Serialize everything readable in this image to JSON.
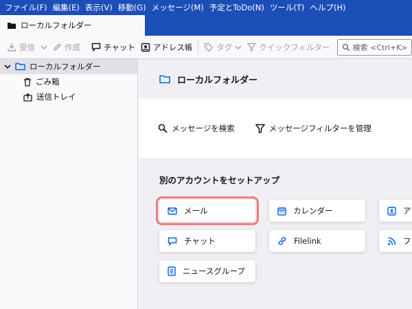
{
  "menu": [
    "ファイル(F)",
    "編集(E)",
    "表示(V)",
    "移動(G)",
    "メッセージ(M)",
    "予定とToDo(N)",
    "ツール(T)",
    "ヘルプ(H)"
  ],
  "tab": {
    "label": "ローカルフォルダー"
  },
  "toolbar": {
    "get_mail": "受信",
    "write": "作成",
    "chat": "チャット",
    "address_book": "アドレス帳",
    "tag": "タグ",
    "quick_filter": "クイックフィルター",
    "search_placeholder": "検索 <Ctrl+K>"
  },
  "sidebar": {
    "account": "ローカルフォルダー",
    "folders": [
      "ごみ箱",
      "送信トレイ"
    ]
  },
  "content": {
    "title": "ローカルフォルダー",
    "search_messages": "メッセージを検索",
    "manage_filters": "メッセージフィルターを管理",
    "setup_title": "別のアカウントをセットアップ",
    "cards": {
      "mail": "メール",
      "calendar": "カレンダー",
      "address": "ア",
      "chat": "チャット",
      "filelink": "Filelink",
      "feed": "フ",
      "newsgroup": "ニュースグループ"
    }
  },
  "colors": {
    "accent": "#1c4eb8",
    "icon_blue": "#0061e0",
    "highlight": "#f07b7b"
  }
}
